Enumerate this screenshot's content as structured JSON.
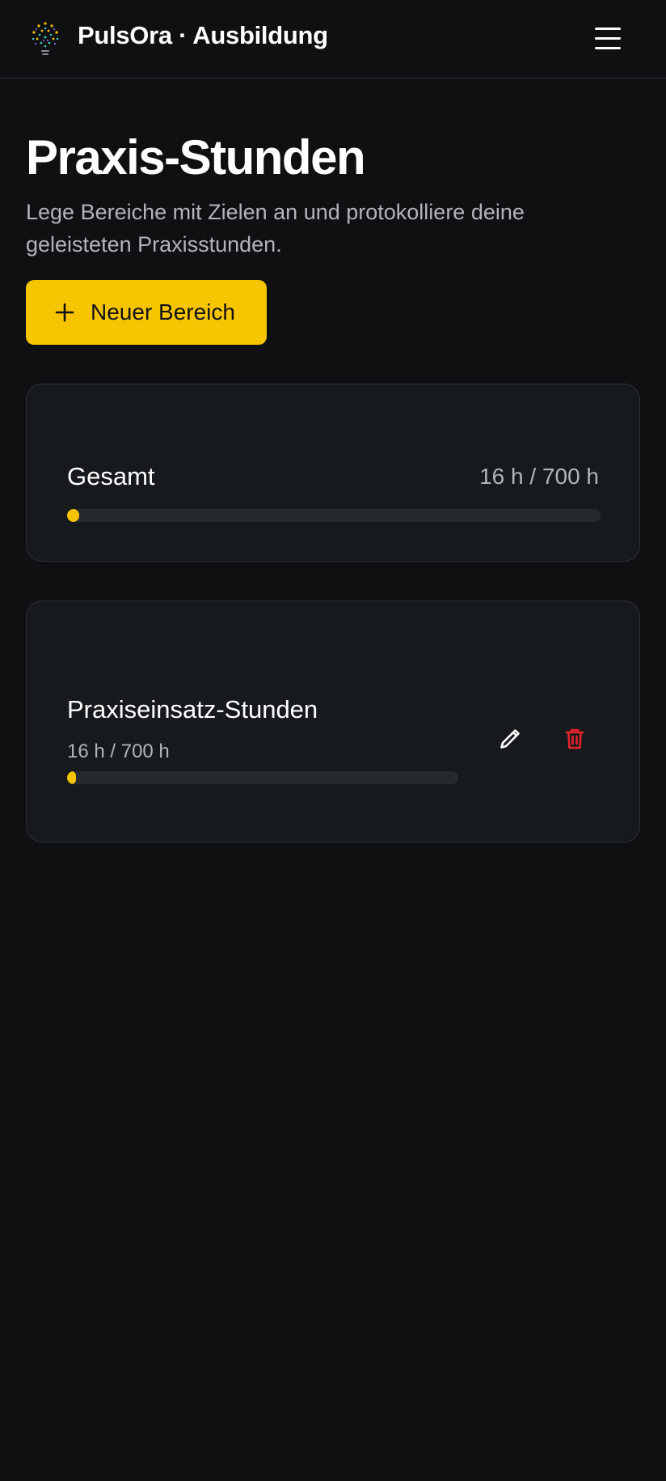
{
  "header": {
    "brand": "PulsOra · Ausbildung",
    "logo_icon": "lightbulb-dots-logo",
    "menu_icon": "hamburger-menu-icon"
  },
  "main": {
    "title": "Praxis-Stunden",
    "description": "Lege Bereiche mit Zielen an und protokolliere deine geleisteten Praxisstunden.",
    "new_button_label": "Neuer Bereich",
    "new_button_icon": "plus-icon"
  },
  "total": {
    "label": "Gesamt",
    "value_text": "16 h / 700 h",
    "progress": 0.0229
  },
  "areas": [
    {
      "name": "Praxiseinsatz-Stunden",
      "value_text": "16 h / 700 h",
      "progress": 0.0229,
      "edit_icon": "pencil-icon",
      "delete_icon": "trash-icon"
    }
  ],
  "colors": {
    "background": "#0f1012",
    "card": "#171a1d",
    "accent": "#f7c400",
    "danger": "#e5242b",
    "muted_text": "#b1b5ba"
  }
}
